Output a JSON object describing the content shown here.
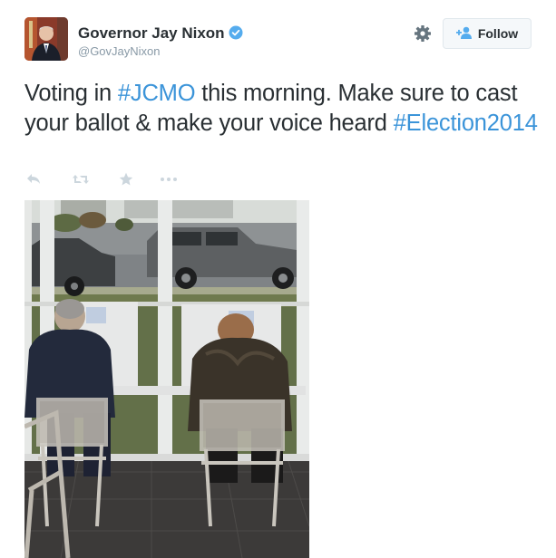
{
  "user": {
    "name": "Governor Jay Nixon",
    "handle": "@GovJayNixon"
  },
  "follow": {
    "label": "Follow"
  },
  "tweet": {
    "part1": "Voting in ",
    "hashtag1": "#JCMO",
    "part2": " this morning. Make sure to cast your ballot & make your voice heard ",
    "hashtag2": "#Election2014"
  },
  "actions": [
    "reply",
    "retweet",
    "favorite",
    "more"
  ],
  "colors": {
    "link": "#3b94d9",
    "verified": "#55acee",
    "muted": "#8899a6",
    "icons": "#ccd6dd"
  }
}
